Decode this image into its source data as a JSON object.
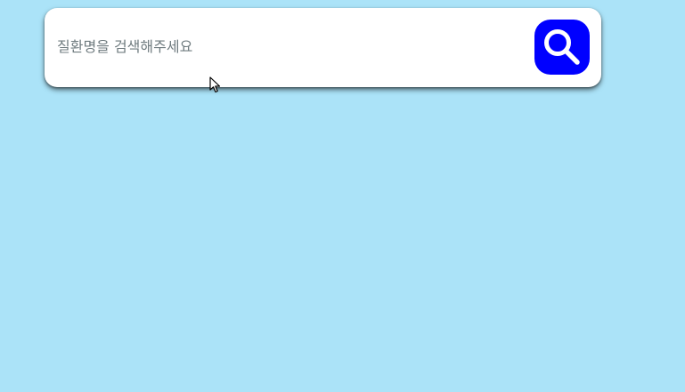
{
  "search": {
    "placeholder": "질환명을 검색해주세요",
    "value": "",
    "button_icon": "search-icon"
  },
  "colors": {
    "background": "#abe3f8",
    "search_bar": "#ffffff",
    "button": "#0000ff",
    "placeholder_text": "#6f7b7f"
  }
}
